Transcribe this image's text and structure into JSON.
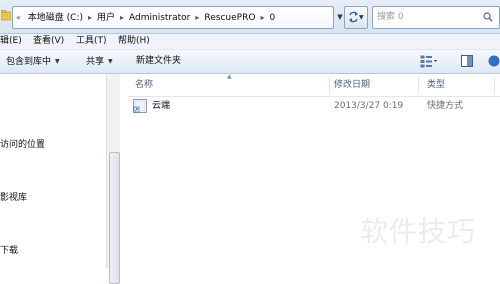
{
  "address_bar": {
    "overflow_chevron": "«",
    "breadcrumbs": [
      "本地磁盘 (C:)",
      "用户",
      "Administrator",
      "RescuePRO",
      "0"
    ],
    "separator": "▸",
    "search_placeholder": "搜索 0"
  },
  "menu": [
    {
      "label": "辑(E)"
    },
    {
      "label": "查看(V)"
    },
    {
      "label": "工具(T)"
    },
    {
      "label": "帮助(H)"
    }
  ],
  "toolbar": {
    "include_in_library": "包含到库中",
    "share": "共享",
    "new_folder": "新建文件夹",
    "dropdown_arrow": "▼"
  },
  "nav": {
    "items": [
      "访问的位置",
      "影视库",
      "下载"
    ]
  },
  "columns": {
    "name": "名称",
    "date_modified": "修改日期",
    "type": "类型",
    "sort_arrow": "▲"
  },
  "files": [
    {
      "name": "云端",
      "date_modified": "2013/3/27 0:19",
      "type": "快捷方式",
      "icon": "shortcut-icon"
    }
  ],
  "watermark": "软件技巧"
}
